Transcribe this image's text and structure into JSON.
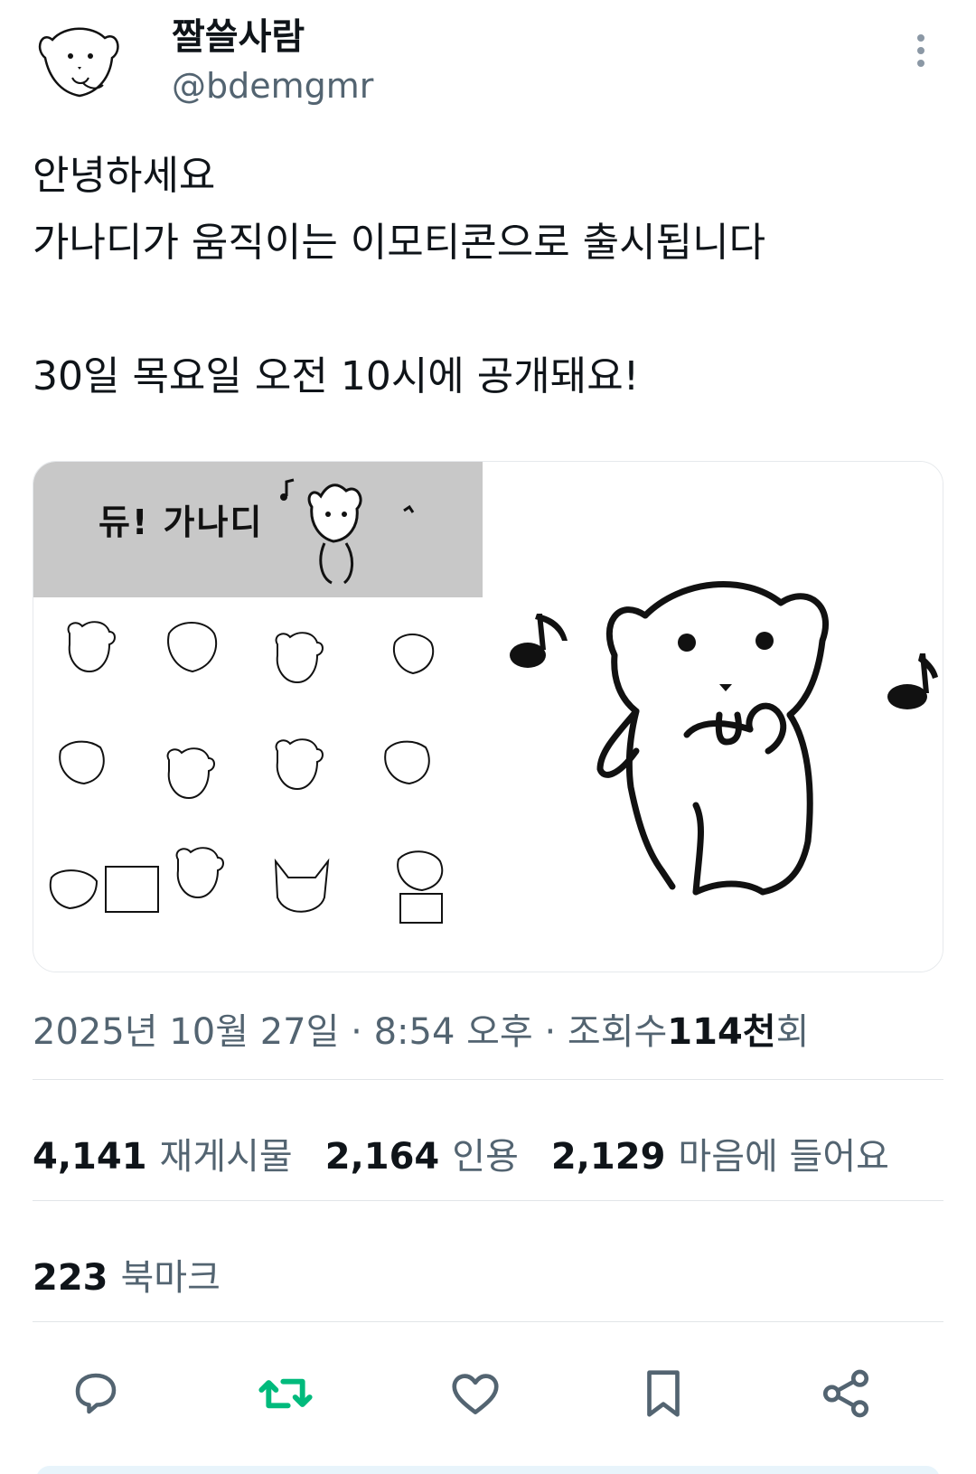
{
  "author": {
    "display_name": "짤쓸사람",
    "handle": "@bdemgmr"
  },
  "tweet": {
    "text": "안녕하세요\n가나디가 움직이는 이모티콘으로 출시됩니다\n\n30일 목요일 오전 10시에 공개돼요!"
  },
  "media": {
    "banner_text": "듀! 가나디"
  },
  "meta": {
    "date": "2025년 10월 27일",
    "separator": "·",
    "time": "8:54 오후",
    "views_prefix": "조회수",
    "views_count": "114천",
    "views_suffix": "회"
  },
  "stats": {
    "reposts_count": "4,141",
    "reposts_label": "재게시물",
    "quotes_count": "2,164",
    "quotes_label": "인용",
    "likes_count": "2,129",
    "likes_label": "마음에 들어요",
    "bookmarks_count": "223",
    "bookmarks_label": "북마크"
  },
  "actions": [
    {
      "icon": "reply-icon"
    },
    {
      "icon": "repost-icon",
      "color": "#00ba7c"
    },
    {
      "icon": "like-icon"
    },
    {
      "icon": "bookmark-icon"
    },
    {
      "icon": "share-icon"
    }
  ],
  "colors": {
    "text": "#0f1419",
    "secondary": "#536471",
    "repost_active": "#00ba7c",
    "divider": "#e1e5e8"
  }
}
